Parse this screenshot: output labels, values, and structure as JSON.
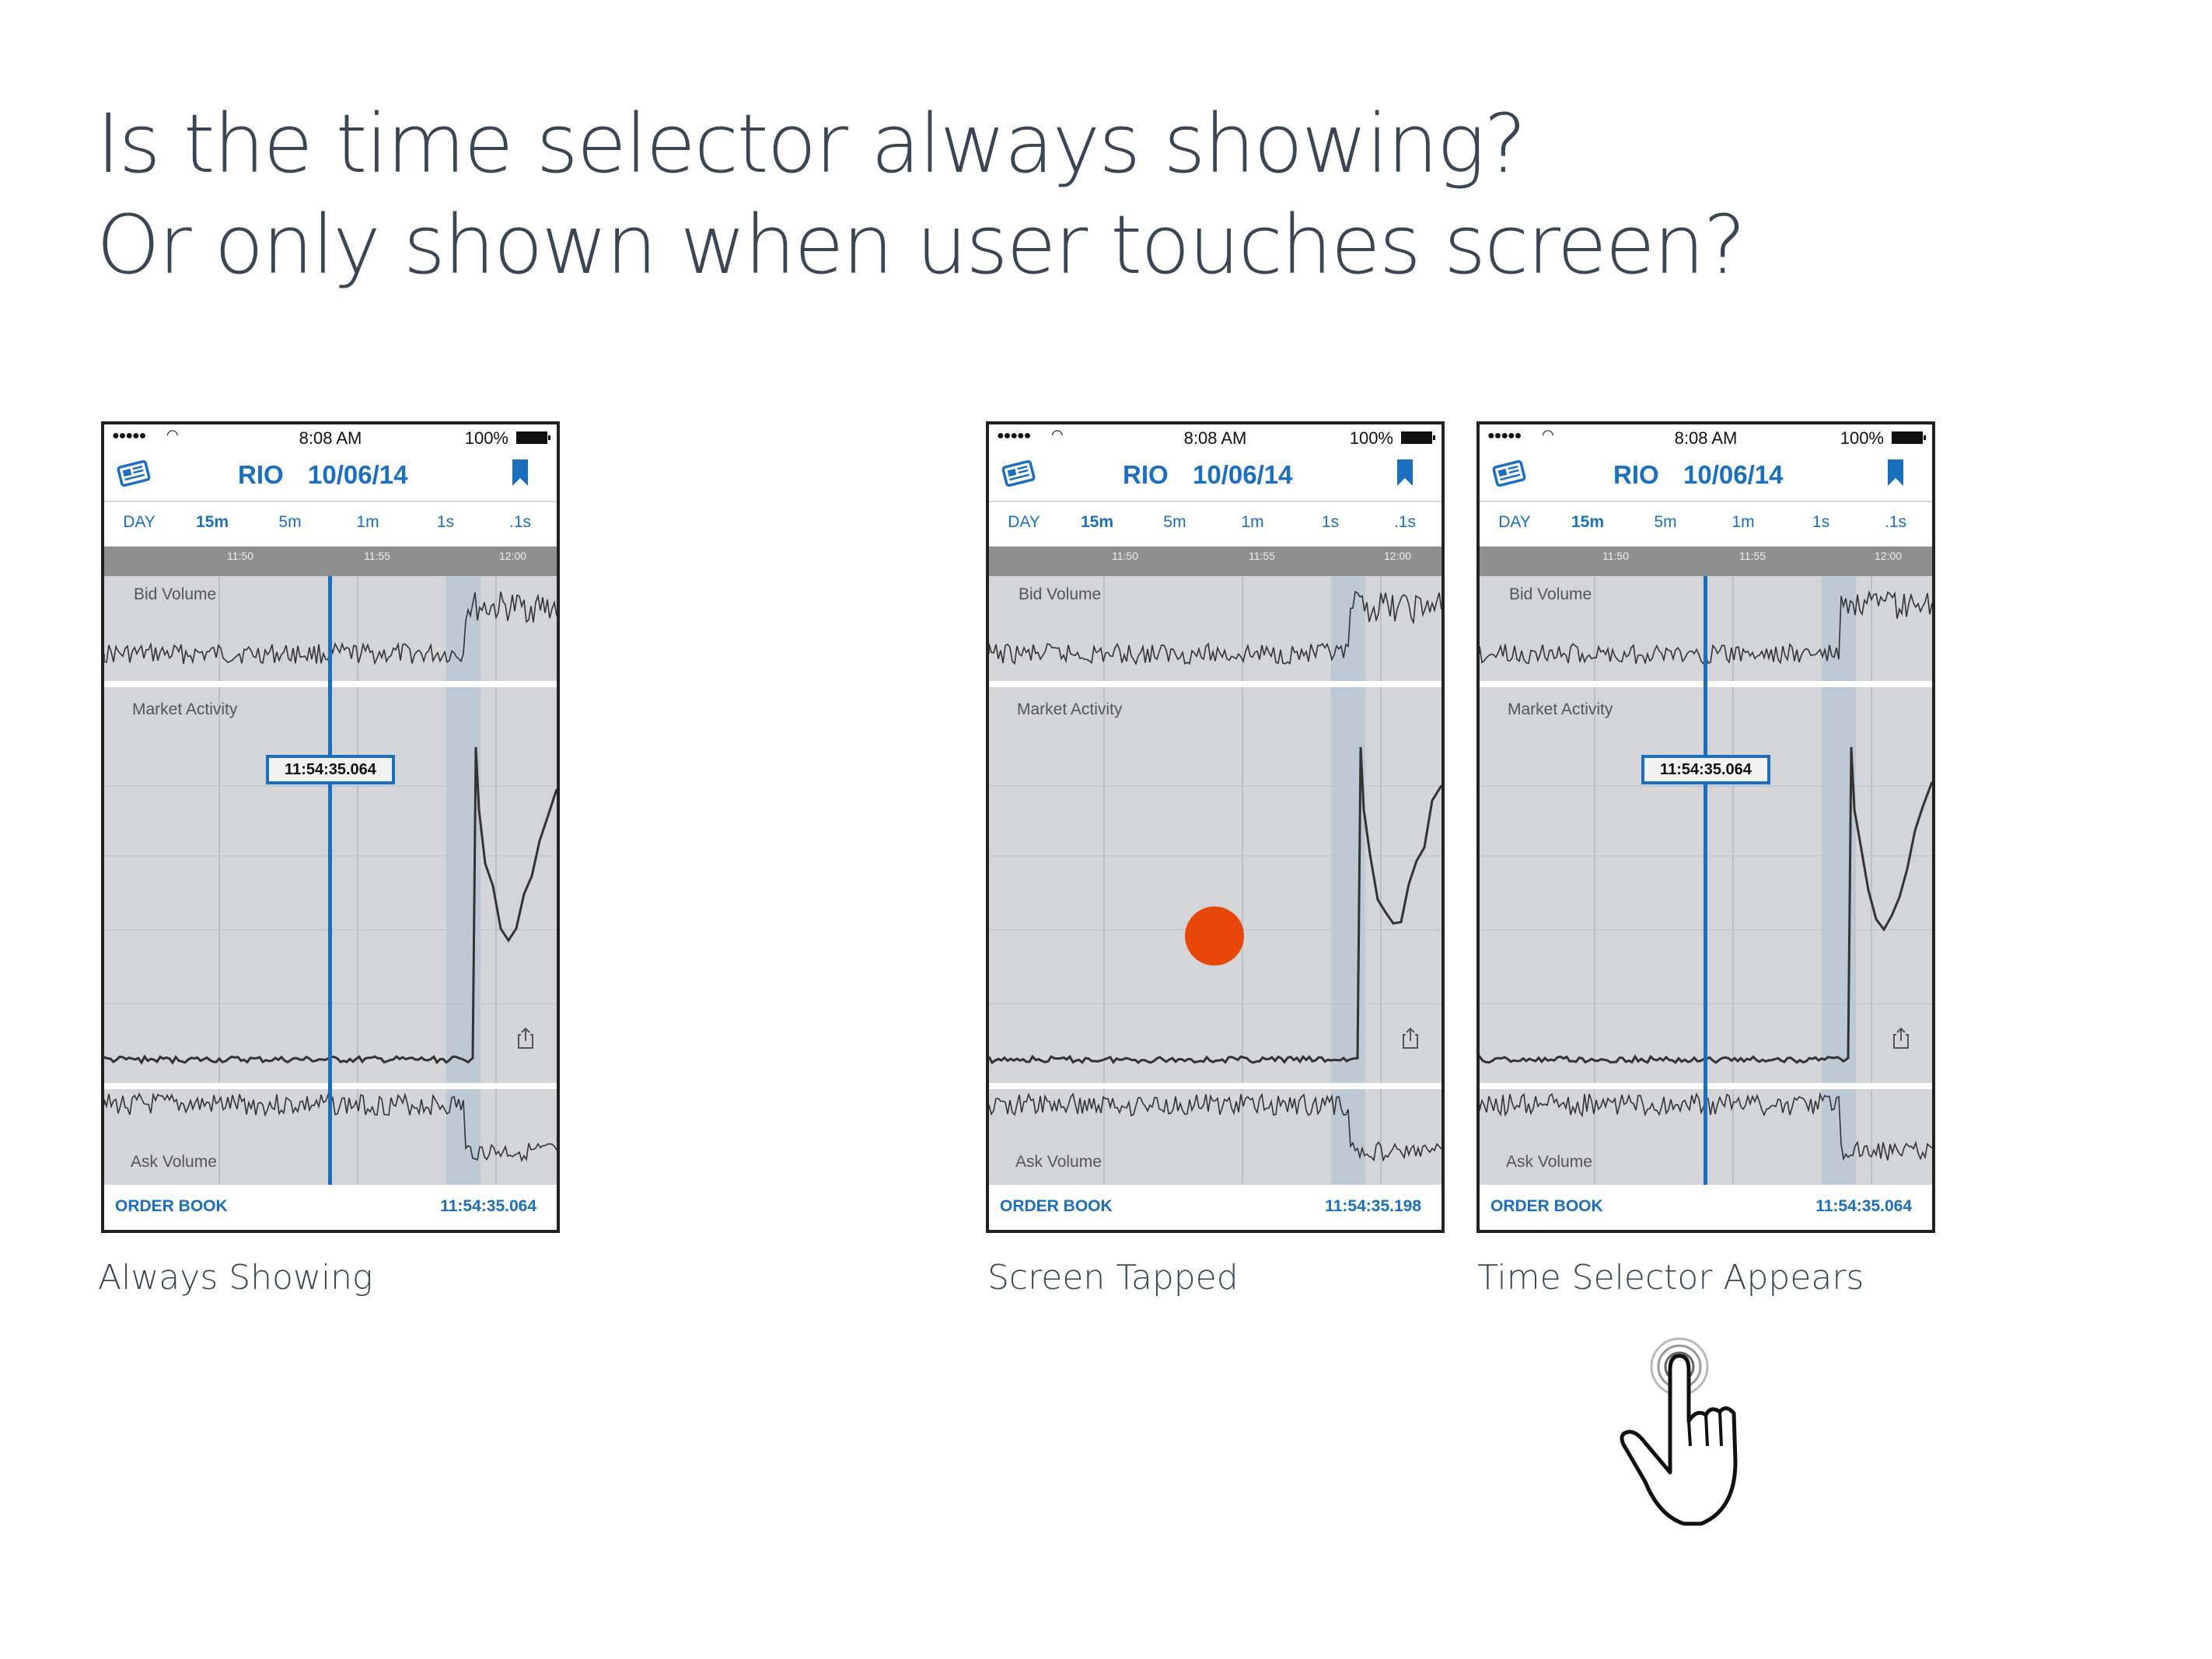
{
  "heading": {
    "line1": "Is the time selector always showing?",
    "line2": "Or only shown when user touches screen?"
  },
  "colors": {
    "accent": "#1b6fbf",
    "tap_dot": "#e8470a",
    "chart_bg": "#d4d5d8",
    "highlight_band": "#b6c6d5",
    "heading_text": "#3b4654"
  },
  "phones": [
    {
      "status": {
        "time": "8:08 AM",
        "battery": "100%"
      },
      "title": {
        "symbol": "RIO",
        "date": "10/06/14"
      },
      "tabs": [
        "DAY",
        "15m",
        "5m",
        "1m",
        "1s",
        ".1s"
      ],
      "active_tab": "15m",
      "ruler_ticks": [
        "11:50",
        "11:55",
        "12:00"
      ],
      "labels": {
        "bid": "Bid Volume",
        "market": "Market Activity",
        "ask": "Ask Volume"
      },
      "selector": {
        "shown": true,
        "time": "11:54:35.064"
      },
      "footer": {
        "order_book": "ORDER BOOK",
        "timestamp": "11:54:35.064"
      },
      "caption": "Always Showing",
      "icons": [
        "news-icon",
        "bookmark-icon",
        "share-icon"
      ]
    },
    {
      "status": {
        "time": "8:08 AM",
        "battery": "100%"
      },
      "title": {
        "symbol": "RIO",
        "date": "10/06/14"
      },
      "tabs": [
        "DAY",
        "15m",
        "5m",
        "1m",
        "1s",
        ".1s"
      ],
      "active_tab": "15m",
      "ruler_ticks": [
        "11:50",
        "11:55",
        "12:00"
      ],
      "labels": {
        "bid": "Bid Volume",
        "market": "Market Activity",
        "ask": "Ask Volume"
      },
      "selector": {
        "shown": false
      },
      "tap_indicator": true,
      "footer": {
        "order_book": "ORDER BOOK",
        "timestamp": "11:54:35.198"
      },
      "caption": "Screen Tapped",
      "icons": [
        "news-icon",
        "bookmark-icon",
        "share-icon"
      ]
    },
    {
      "status": {
        "time": "8:08 AM",
        "battery": "100%"
      },
      "title": {
        "symbol": "RIO",
        "date": "10/06/14"
      },
      "tabs": [
        "DAY",
        "15m",
        "5m",
        "1m",
        "1s",
        ".1s"
      ],
      "active_tab": "15m",
      "ruler_ticks": [
        "11:50",
        "11:55",
        "12:00"
      ],
      "labels": {
        "bid": "Bid Volume",
        "market": "Market Activity",
        "ask": "Ask Volume"
      },
      "selector": {
        "shown": true,
        "time": "11:54:35.064"
      },
      "footer": {
        "order_book": "ORDER BOOK",
        "timestamp": "11:54:35.064"
      },
      "caption": "Time Selector Appears",
      "icons": [
        "news-icon",
        "bookmark-icon",
        "share-icon"
      ]
    }
  ],
  "decorations": {
    "hand_icon": "tap-hand-icon"
  }
}
